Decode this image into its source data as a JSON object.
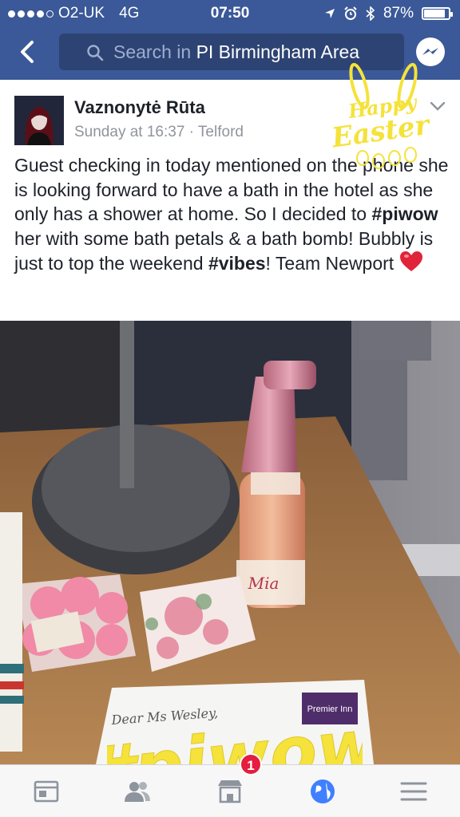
{
  "status_bar": {
    "carrier": "O2-UK",
    "network": "4G",
    "time": "07:50",
    "battery": "87%",
    "battery_level": 0.87
  },
  "nav": {
    "search_prefix": "Search in ",
    "search_group": "PI Birmingham Area"
  },
  "post": {
    "author": "Vaznonytė Rūta",
    "meta": "Sunday at 16:37 · Telford",
    "text_1": "Guest checking in today mentioned on the phone she is looking forward to have a bath in the hotel as she only has a shower at home. So I decided to ",
    "hashtag_1": "#piwow",
    "text_2": " her with some bath petals & a bath bomb!  Bubbly is just to top the weekend ",
    "hashtag_2": "#vibes",
    "text_3": "! Team Newport "
  },
  "overlay": {
    "easter_line1": "Happy",
    "easter_line2": "Easter",
    "piwow": "#piwow"
  },
  "photo": {
    "bottle_label": "Mia",
    "card_text": "Dear Ms Wesley,",
    "brand": "Premier Inn"
  },
  "tabbar": {
    "notifications_badge": "1",
    "active_tab": "globe"
  },
  "colors": {
    "brand_blue": "#3b5998",
    "search_bg": "#2d4373",
    "badge_red": "#e41e3f",
    "active_tab": "#4080ff",
    "inactive_tab": "#8d949e",
    "overlay_yellow": "#f5e23a"
  }
}
